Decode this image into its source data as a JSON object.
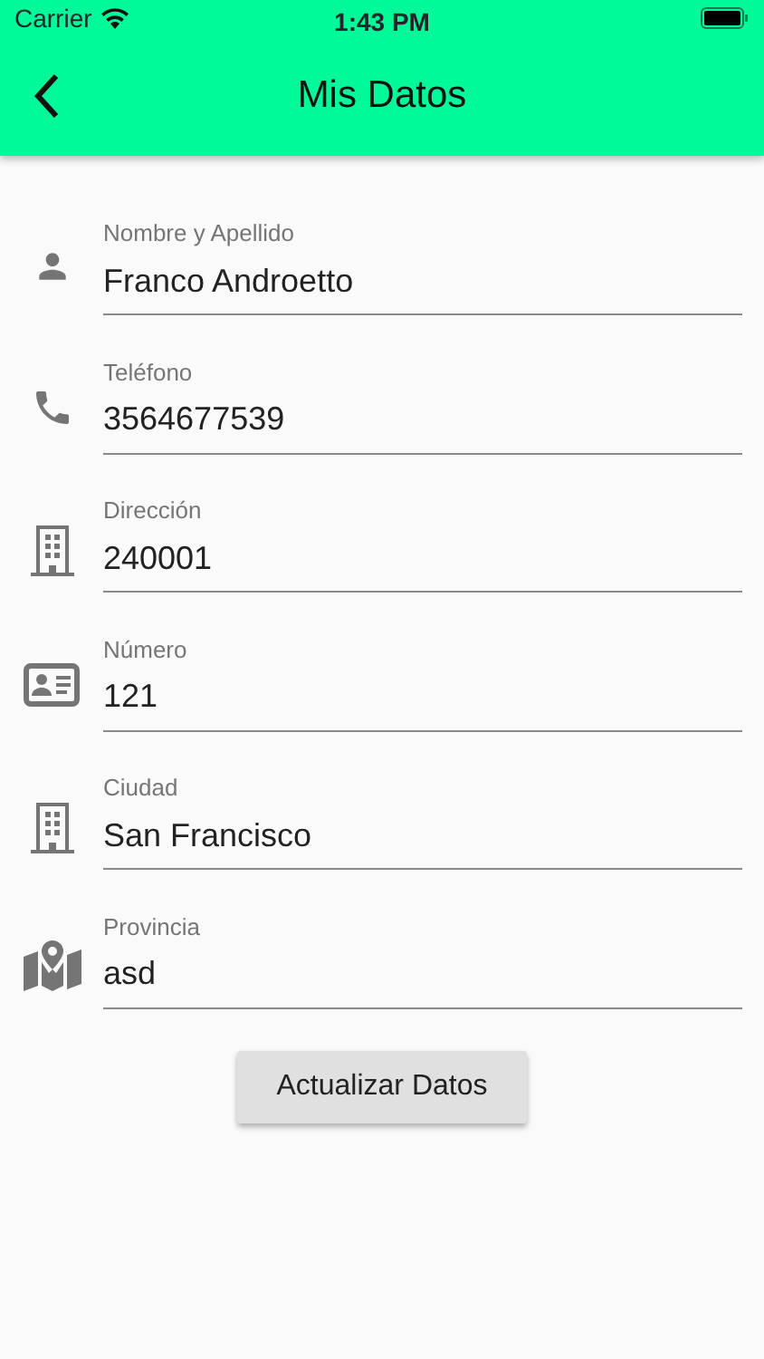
{
  "status_bar": {
    "carrier": "Carrier",
    "time": "1:43 PM"
  },
  "app_bar": {
    "title": "Mis Datos"
  },
  "fields": [
    {
      "kind": "person",
      "label": "Nombre y Apellido",
      "value": "Franco Androetto"
    },
    {
      "kind": "phone",
      "label": "Teléfono",
      "value": "3564677539"
    },
    {
      "kind": "building",
      "label": "Dirección",
      "value": "240001"
    },
    {
      "kind": "id-card",
      "label": "Número",
      "value": "121"
    },
    {
      "kind": "building",
      "label": "Ciudad",
      "value": "San Francisco"
    },
    {
      "kind": "map",
      "label": "Provincia",
      "value": "asd"
    }
  ],
  "button": {
    "label": "Actualizar Datos"
  }
}
